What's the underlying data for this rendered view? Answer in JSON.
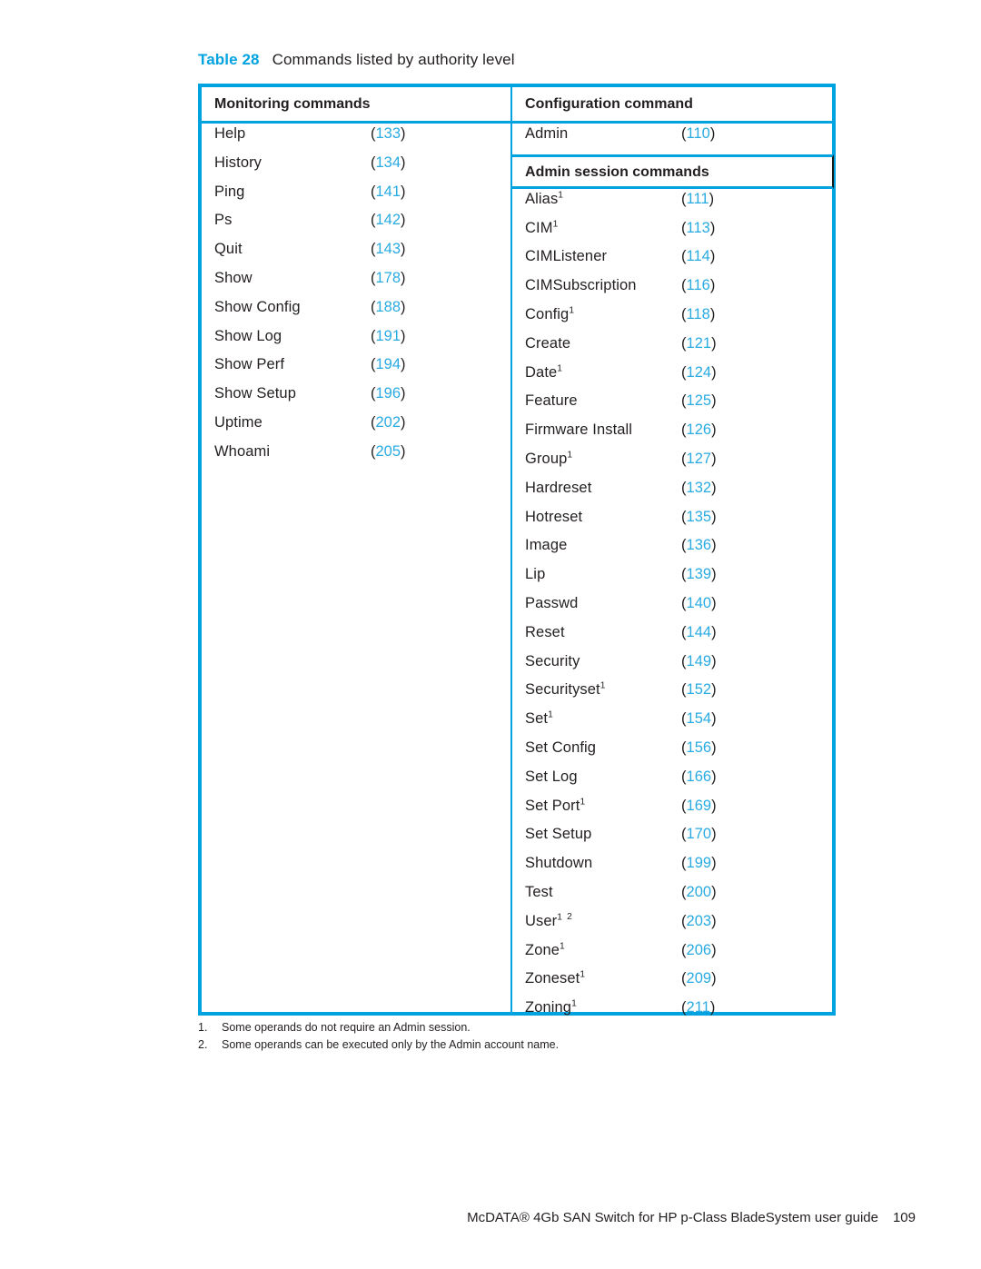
{
  "caption": {
    "label": "Table 28",
    "text": "Commands listed by authority level"
  },
  "colors": {
    "accent": "#00a3e0",
    "page_number_blue": "#29abe2",
    "text": "#231f20"
  },
  "table": {
    "left_column": {
      "header": "Monitoring commands",
      "rows": [
        {
          "name": "Help",
          "page": "133"
        },
        {
          "name": "History",
          "page": "134"
        },
        {
          "name": "Ping",
          "page": "141"
        },
        {
          "name": "Ps",
          "page": "142"
        },
        {
          "name": "Quit",
          "page": "143"
        },
        {
          "name": "Show",
          "page": "178"
        },
        {
          "name": "Show Config",
          "page": "188"
        },
        {
          "name": "Show Log",
          "page": "191"
        },
        {
          "name": "Show Perf",
          "page": "194"
        },
        {
          "name": "Show Setup",
          "page": "196"
        },
        {
          "name": "Uptime",
          "page": "202"
        },
        {
          "name": "Whoami",
          "page": "205"
        }
      ]
    },
    "right_column": {
      "header": "Configuration command",
      "top_rows": [
        {
          "name": "Admin",
          "page": "110"
        }
      ],
      "subheader": "Admin session commands",
      "rows": [
        {
          "name": "Alias",
          "sup": "1",
          "page": "111"
        },
        {
          "name": "CIM",
          "sup": "1",
          "page": "113"
        },
        {
          "name": "CIMListener",
          "sup": "",
          "page": "114"
        },
        {
          "name": "CIMSubscription",
          "sup": "",
          "page": "116"
        },
        {
          "name": "Config",
          "sup": "1",
          "page": "118"
        },
        {
          "name": "Create",
          "sup": "",
          "page": "121"
        },
        {
          "name": "Date",
          "sup": "1",
          "page": "124"
        },
        {
          "name": "Feature",
          "sup": "",
          "page": "125"
        },
        {
          "name": "Firmware Install",
          "sup": "",
          "page": "126"
        },
        {
          "name": "Group",
          "sup": "1",
          "page": "127"
        },
        {
          "name": "Hardreset",
          "sup": "",
          "page": "132"
        },
        {
          "name": "Hotreset",
          "sup": "",
          "page": "135"
        },
        {
          "name": "Image",
          "sup": "",
          "page": "136"
        },
        {
          "name": "Lip",
          "sup": "",
          "page": "139"
        },
        {
          "name": "Passwd",
          "sup": "",
          "page": "140"
        },
        {
          "name": "Reset",
          "sup": "",
          "page": "144"
        },
        {
          "name": "Security",
          "sup": "",
          "page": "149"
        },
        {
          "name": "Securityset",
          "sup": "1",
          "page": "152"
        },
        {
          "name": "Set",
          "sup": "1",
          "page": "154"
        },
        {
          "name": "Set Config",
          "sup": "",
          "page": "156"
        },
        {
          "name": "Set Log",
          "sup": "",
          "page": "166"
        },
        {
          "name": "Set Port",
          "sup": "1",
          "page": "169"
        },
        {
          "name": "Set Setup",
          "sup": "",
          "page": "170"
        },
        {
          "name": "Shutdown",
          "sup": "",
          "page": "199"
        },
        {
          "name": "Test",
          "sup": "",
          "page": "200"
        },
        {
          "name": "User",
          "sup": "1",
          "sup2": "2",
          "page": "203"
        },
        {
          "name": "Zone",
          "sup": "1",
          "page": "206"
        },
        {
          "name": "Zoneset",
          "sup": "1",
          "page": "209"
        },
        {
          "name": "Zoning",
          "sup": "1",
          "page": "211"
        }
      ]
    }
  },
  "footnotes": [
    {
      "num": "1.",
      "text": "Some operands do not require an Admin session."
    },
    {
      "num": "2.",
      "text": "Some operands can be executed only by the Admin account name."
    }
  ],
  "footer": {
    "title": "McDATA® 4Gb SAN Switch for HP p-Class BladeSystem user guide",
    "page_number": "109"
  }
}
